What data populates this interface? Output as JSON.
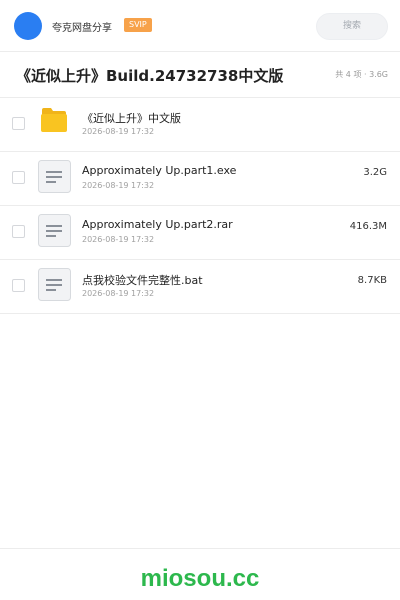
{
  "header": {
    "user_name": "夸克网盘分享",
    "badge": "SVIP",
    "search_placeholder": "搜索"
  },
  "share": {
    "title": "《近似上升》Build.24732738中文版",
    "summary": "共 4 项 · 3.6G"
  },
  "files": [
    {
      "type": "folder",
      "icon": "folder-icon",
      "name": "《近似上升》中文版",
      "date": "2026-08-19 17:32",
      "size": ""
    },
    {
      "type": "file",
      "icon": "file-icon",
      "name": "Approximately Up.part1.exe",
      "date": "2026-08-19 17:32",
      "size": "3.2G"
    },
    {
      "type": "file",
      "icon": "file-icon",
      "name": "Approximately Up.part2.rar",
      "date": "2026-08-19 17:32",
      "size": "416.3M"
    },
    {
      "type": "file",
      "icon": "file-icon",
      "name": "点我校验文件完整性.bat",
      "date": "2026-08-19 17:32",
      "size": "8.7KB"
    }
  ],
  "watermark": "miosou.cc",
  "colors": {
    "accent": "#2a7ef2",
    "badge": "#f7a24a",
    "folder": "#f9c421",
    "watermark": "#2db84d"
  }
}
